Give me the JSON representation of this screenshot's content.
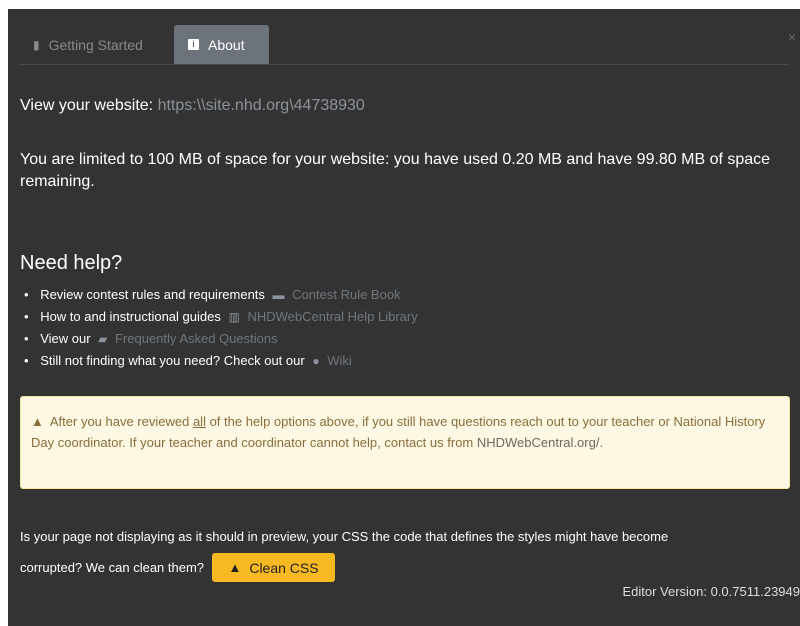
{
  "tabs": [
    {
      "label": "Getting Started",
      "icon": "book-icon",
      "active": false
    },
    {
      "label": "About",
      "icon": "info-icon",
      "active": true
    }
  ],
  "close_label": "×",
  "website": {
    "label": "View your website:",
    "url": "https:\\\\site.nhd.org\\44738930"
  },
  "quota": {
    "text": "You are limited to 100 MB of space for your website: you have used 0.20 MB and have 99.80 MB of space remaining."
  },
  "help": {
    "title": "Need help?",
    "items": [
      {
        "text": "Review contest rules and requirements",
        "icon": "book-icon",
        "link": "Contest Rule Book"
      },
      {
        "text": "How to and instructional guides",
        "icon": "library-icon",
        "link": "NHDWebCentral Help Library"
      },
      {
        "text": "View our",
        "icon": "comments-icon",
        "link": "Frequently Asked Questions"
      },
      {
        "text": "Still not finding what you need? Check out our",
        "icon": "users-icon",
        "link": "Wiki"
      }
    ]
  },
  "alert": {
    "before": "After you have reviewed ",
    "emph": "all",
    "after": " of the help options above, if you still have questions reach out to your teacher or National History Day coordinator. If your teacher and coordinator cannot help, contact us from ",
    "link": "NHDWebCentral.org/",
    "end": "."
  },
  "css": {
    "note_line1": "Is your page not displaying as it should in preview, your CSS the code that defines the styles might have become",
    "note_line2": "corrupted? We can clean them?",
    "button_label": "Clean CSS"
  },
  "version": "Editor Version: 0.0.7511.23949",
  "colors": {
    "panel": "#333333",
    "active_tab": "#6d737b",
    "button": "#f6b922",
    "alert_bg": "#fcf8e3"
  }
}
